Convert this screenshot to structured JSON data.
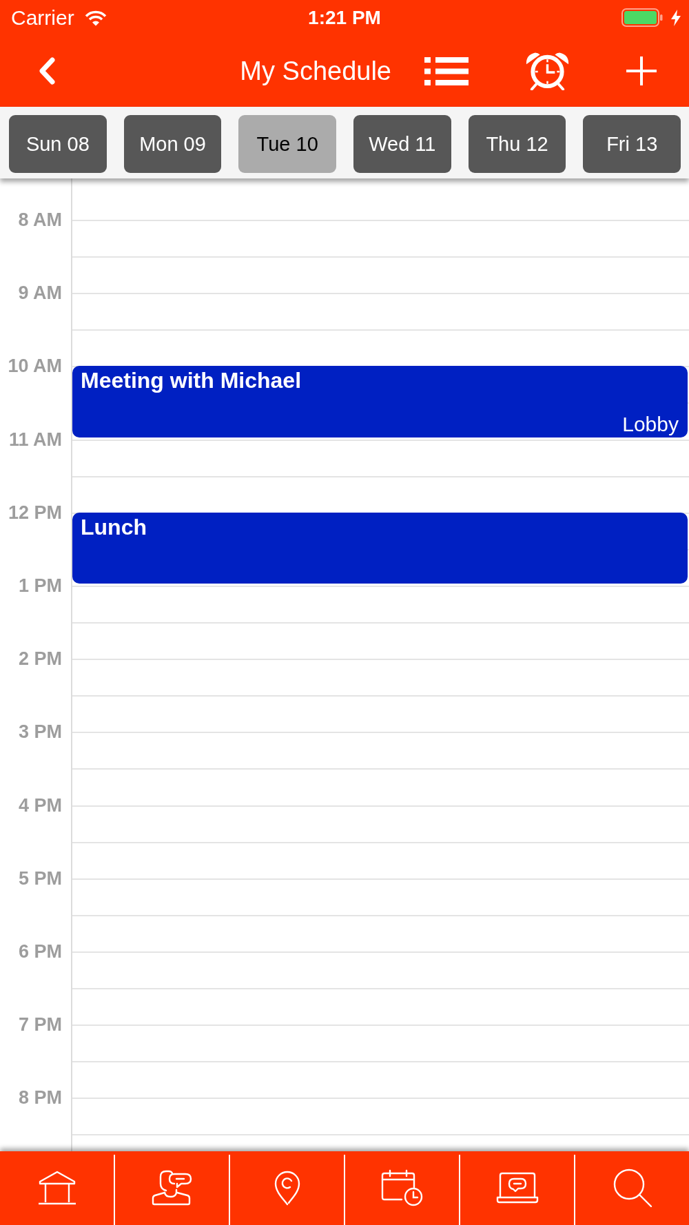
{
  "status_bar": {
    "carrier": "Carrier",
    "time": "1:21 PM",
    "charging": true
  },
  "nav": {
    "title": "My Schedule",
    "actions": [
      {
        "kind": "list"
      },
      {
        "kind": "alarm"
      },
      {
        "kind": "add"
      }
    ]
  },
  "days": [
    {
      "label": "Sun 08",
      "selected": false
    },
    {
      "label": "Mon 09",
      "selected": false
    },
    {
      "label": "Tue 10",
      "selected": true
    },
    {
      "label": "Wed 11",
      "selected": false
    },
    {
      "label": "Thu 12",
      "selected": false
    },
    {
      "label": "Fri 13",
      "selected": false
    }
  ],
  "timeline": {
    "hours": [
      {
        "label": "8 AM"
      },
      {
        "label": "9 AM"
      },
      {
        "label": "10 AM",
        "events": [
          {
            "title": "Meeting with Michael",
            "location": "Lobby"
          }
        ]
      },
      {
        "label": "11 AM"
      },
      {
        "label": "12 PM",
        "events": [
          {
            "title": "Lunch"
          }
        ]
      },
      {
        "label": "1 PM"
      },
      {
        "label": "2 PM"
      },
      {
        "label": "3 PM"
      },
      {
        "label": "4 PM"
      },
      {
        "label": "5 PM"
      },
      {
        "label": "6 PM"
      },
      {
        "label": "7 PM"
      },
      {
        "label": "8 PM"
      }
    ]
  },
  "tab_bar": [
    {
      "kind": "home"
    },
    {
      "kind": "contact"
    },
    {
      "kind": "location"
    },
    {
      "kind": "calendar"
    },
    {
      "kind": "laptop-chat"
    },
    {
      "kind": "search"
    }
  ]
}
